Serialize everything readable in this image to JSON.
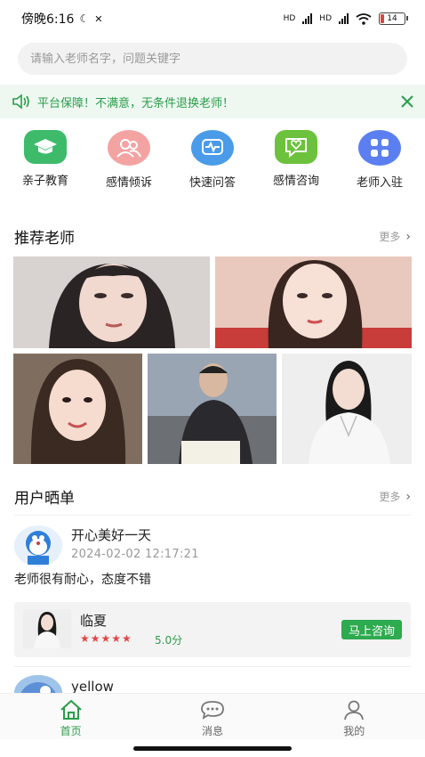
{
  "status_bar": {
    "time": "傍晚6:16",
    "network_1": "HD",
    "network_2": "HD",
    "battery": "14"
  },
  "search": {
    "placeholder": "请输入老师名字，问题关键字"
  },
  "notice": {
    "text": "平台保障！不满意，无条件退换老师！"
  },
  "categories": [
    {
      "label": "亲子教育",
      "icon": "graduation-cap-icon",
      "color": "#3dbb6a"
    },
    {
      "label": "感情倾诉",
      "icon": "people-icon",
      "color": "#f4a3a3"
    },
    {
      "label": "快速问答",
      "icon": "heartbeat-monitor-icon",
      "color": "#4a9be8"
    },
    {
      "label": "感情咨询",
      "icon": "heart-chat-icon",
      "color": "#6cc23c"
    },
    {
      "label": "老师入驻",
      "icon": "grid-icon",
      "color": "#5b7ff0"
    }
  ],
  "recommended": {
    "title": "推荐老师",
    "more": "更多"
  },
  "showcase": {
    "title": "用户晒单",
    "more": "更多",
    "post": {
      "username": "开心美好一天",
      "time": "2024-02-02 12:17:21",
      "content": "老师很有耐心，态度不错",
      "teacher": {
        "name": "临夏",
        "rating": 5,
        "stars": "★★★★★",
        "score": "5.0分",
        "consult": "马上咨询"
      }
    },
    "post2": {
      "username": "yellow"
    }
  },
  "tabs": [
    {
      "label": "首页",
      "icon": "home-icon",
      "active": true
    },
    {
      "label": "消息",
      "icon": "message-icon",
      "active": false
    },
    {
      "label": "我的",
      "icon": "profile-icon",
      "active": false
    }
  ],
  "colors": {
    "accent": "#2a9d4a",
    "notice_bg": "#eef8f1",
    "star": "#e64545"
  }
}
